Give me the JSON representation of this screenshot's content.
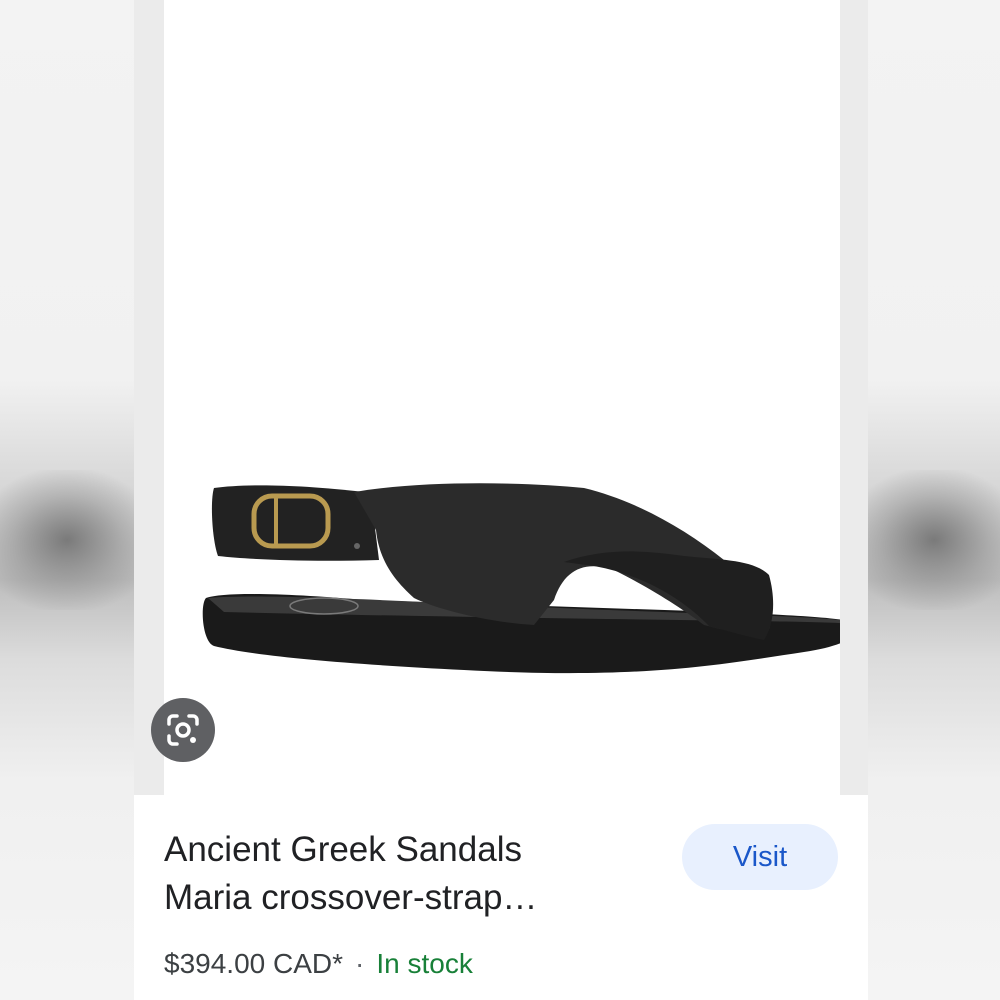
{
  "product": {
    "title_line1": "Ancient Greek Sandals",
    "title_line2": "Maria crossover-strap…",
    "price": "$394.00 CAD*",
    "separator": "·",
    "availability": "In stock",
    "image_alt": "Black leather Ancient Greek Sandals Maria crossover-strap sandal"
  },
  "actions": {
    "visit_label": "Visit",
    "lens_icon": "google-lens-icon"
  },
  "colors": {
    "visit_bg": "#e8f0fe",
    "visit_text": "#1a57c9",
    "in_stock": "#188038",
    "title": "#202124"
  }
}
